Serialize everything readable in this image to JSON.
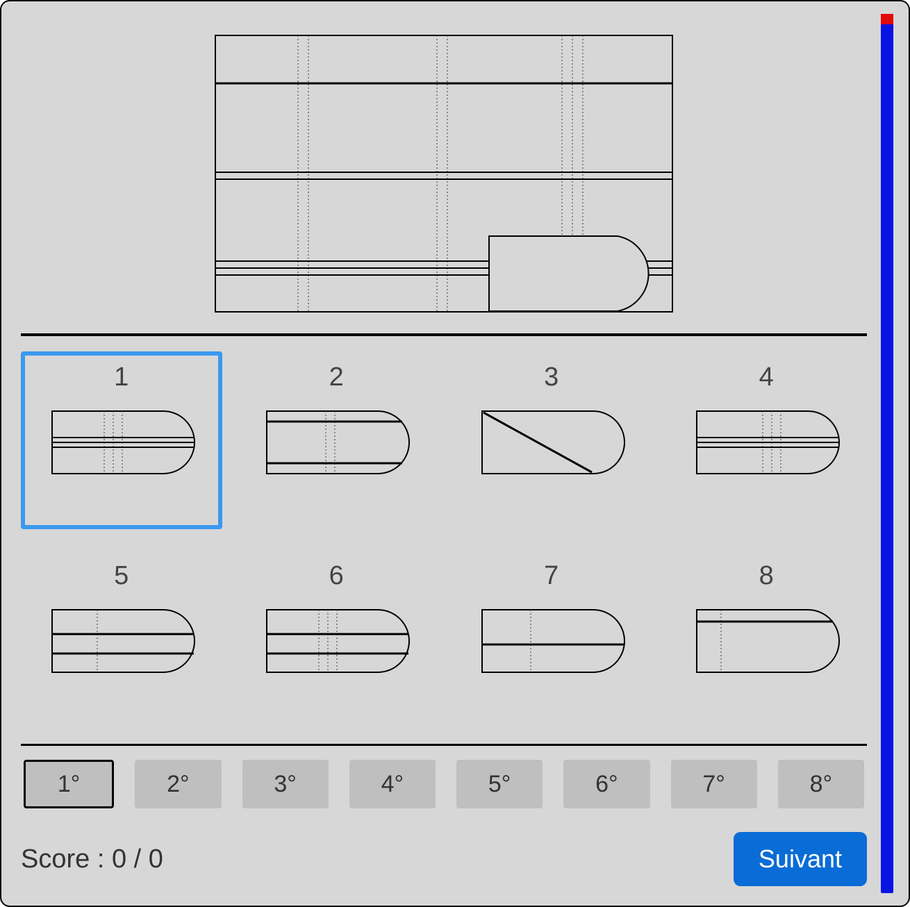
{
  "selected_answer": 1,
  "current_order_slot": 1,
  "answers": [
    {
      "num": "1"
    },
    {
      "num": "2"
    },
    {
      "num": "3"
    },
    {
      "num": "4"
    },
    {
      "num": "5"
    },
    {
      "num": "6"
    },
    {
      "num": "7"
    },
    {
      "num": "8"
    }
  ],
  "order_slots": [
    "1°",
    "2°",
    "3°",
    "4°",
    "5°",
    "6°",
    "7°",
    "8°"
  ],
  "score_label": "Score : 0 / 0",
  "next_label": "Suivant",
  "timer": {
    "used_fraction": 0.012
  }
}
